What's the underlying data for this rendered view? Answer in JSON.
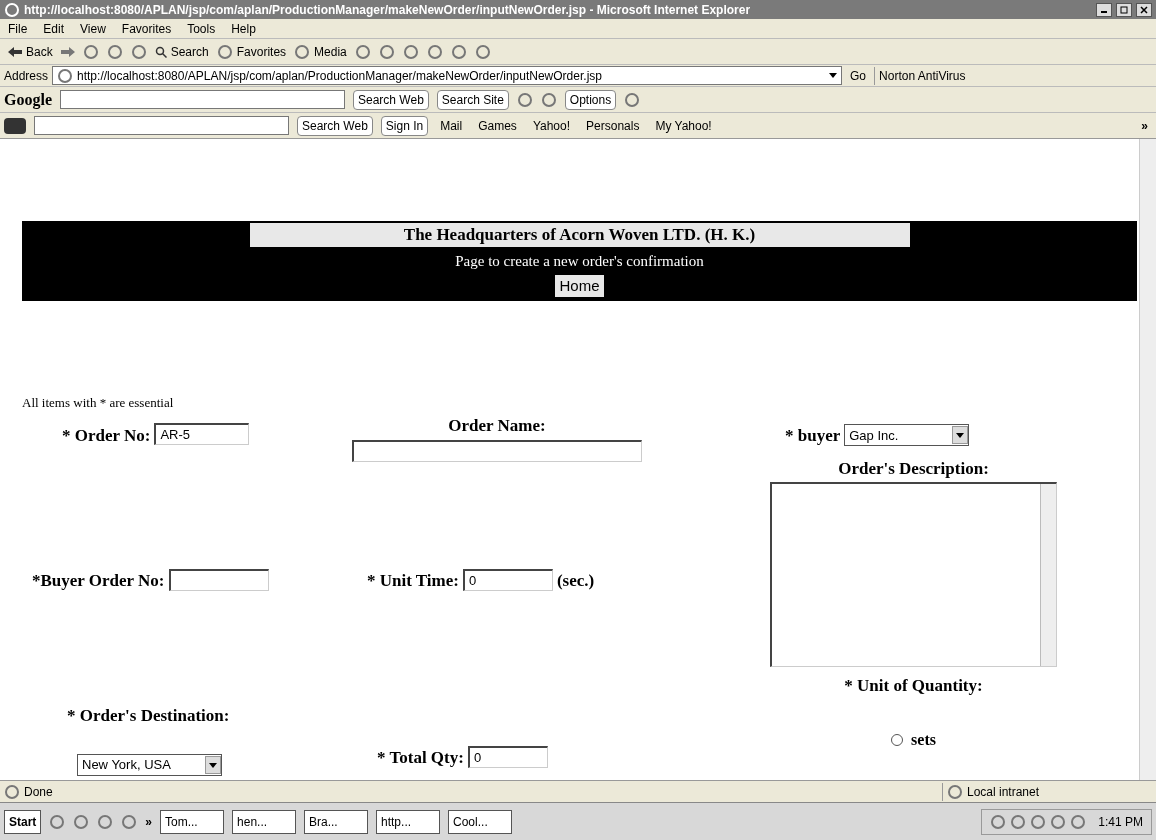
{
  "window": {
    "title": "http://localhost:8080/APLAN/jsp/com/aplan/ProductionManager/makeNewOrder/inputNewOrder.jsp - Microsoft Internet Explorer"
  },
  "menu": [
    "File",
    "Edit",
    "View",
    "Favorites",
    "Tools",
    "Help"
  ],
  "toolbar": {
    "back": "Back",
    "search": "Search",
    "favorites": "Favorites",
    "media": "Media"
  },
  "address": {
    "label": "Address",
    "value": "http://localhost:8080/APLAN/jsp/com/aplan/ProductionManager/makeNewOrder/inputNewOrder.jsp",
    "go": "Go",
    "antivirus": "Norton AntiVirus"
  },
  "google_bar": {
    "logo": "Google",
    "search_web": "Search Web",
    "search_site": "Search Site",
    "options": "Options"
  },
  "yahoo_bar": {
    "search_web": "Search Web",
    "sign_in": "Sign In",
    "items": [
      "Mail",
      "Games",
      "Yahoo!",
      "Personals",
      "My Yahoo!"
    ],
    "more": "»"
  },
  "page": {
    "banner_title": "The Headquarters of Acorn Woven LTD. (H. K.)",
    "banner_subtitle": "Page to create a new order's confirmation",
    "home_button": "Home",
    "note": "All items with * are essential",
    "order_no": {
      "label": "* Order No:",
      "value": "AR-5"
    },
    "order_name": {
      "label": "Order Name:"
    },
    "buyer": {
      "label": "* buyer",
      "value": "Gap Inc."
    },
    "description": {
      "label": "Order's Description:"
    },
    "buyer_order_no": {
      "label": "*Buyer Order No:"
    },
    "unit_time": {
      "label": "* Unit Time:",
      "value": "0",
      "unit": "(sec.)"
    },
    "unit_of_quantity": {
      "label": "* Unit of Quantity:",
      "options": [
        {
          "label": "sets",
          "selected": false
        }
      ]
    },
    "destination": {
      "label": "* Order's Destination:",
      "value": "New York, USA"
    },
    "total_qty": {
      "label": "* Total Qty:",
      "value": "0"
    }
  },
  "status_bar": {
    "text": "Done",
    "zone": "Local intranet"
  },
  "taskbar": {
    "start": "Start",
    "more": "»",
    "tasks": [
      "Tom...",
      "hen...",
      "Bra...",
      "http...",
      "Cool..."
    ],
    "clock": "1:41 PM"
  }
}
